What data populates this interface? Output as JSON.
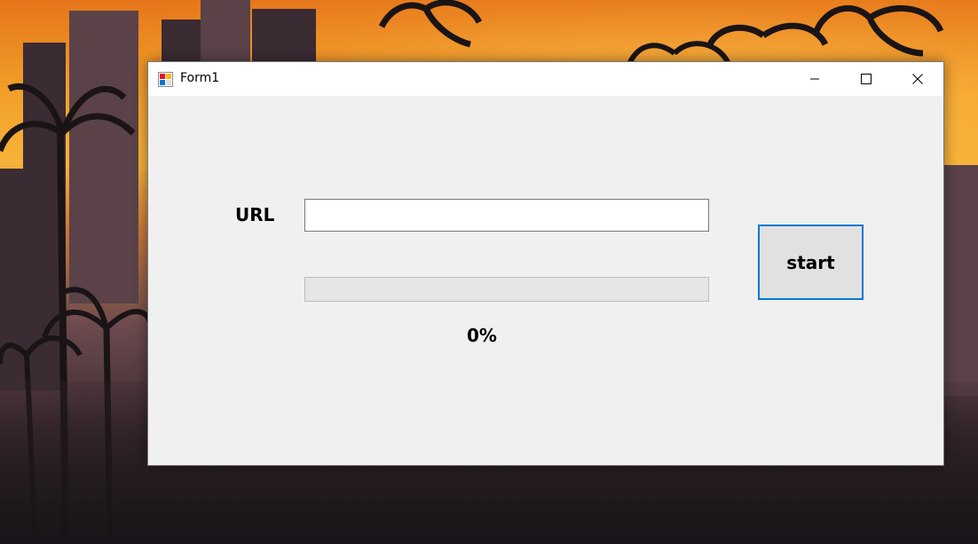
{
  "window": {
    "title": "Form1",
    "controls": {
      "minimize_icon": "minimize-icon",
      "maximize_icon": "maximize-icon",
      "close_icon": "close-icon"
    }
  },
  "form": {
    "url_label": "URL",
    "url_value": "",
    "progress_value": 0,
    "progress_text": "0%",
    "start_label": "start"
  },
  "colors": {
    "accent": "#0078d7",
    "window_bg": "#f0f0f0",
    "progress_fill": "#06b025"
  }
}
